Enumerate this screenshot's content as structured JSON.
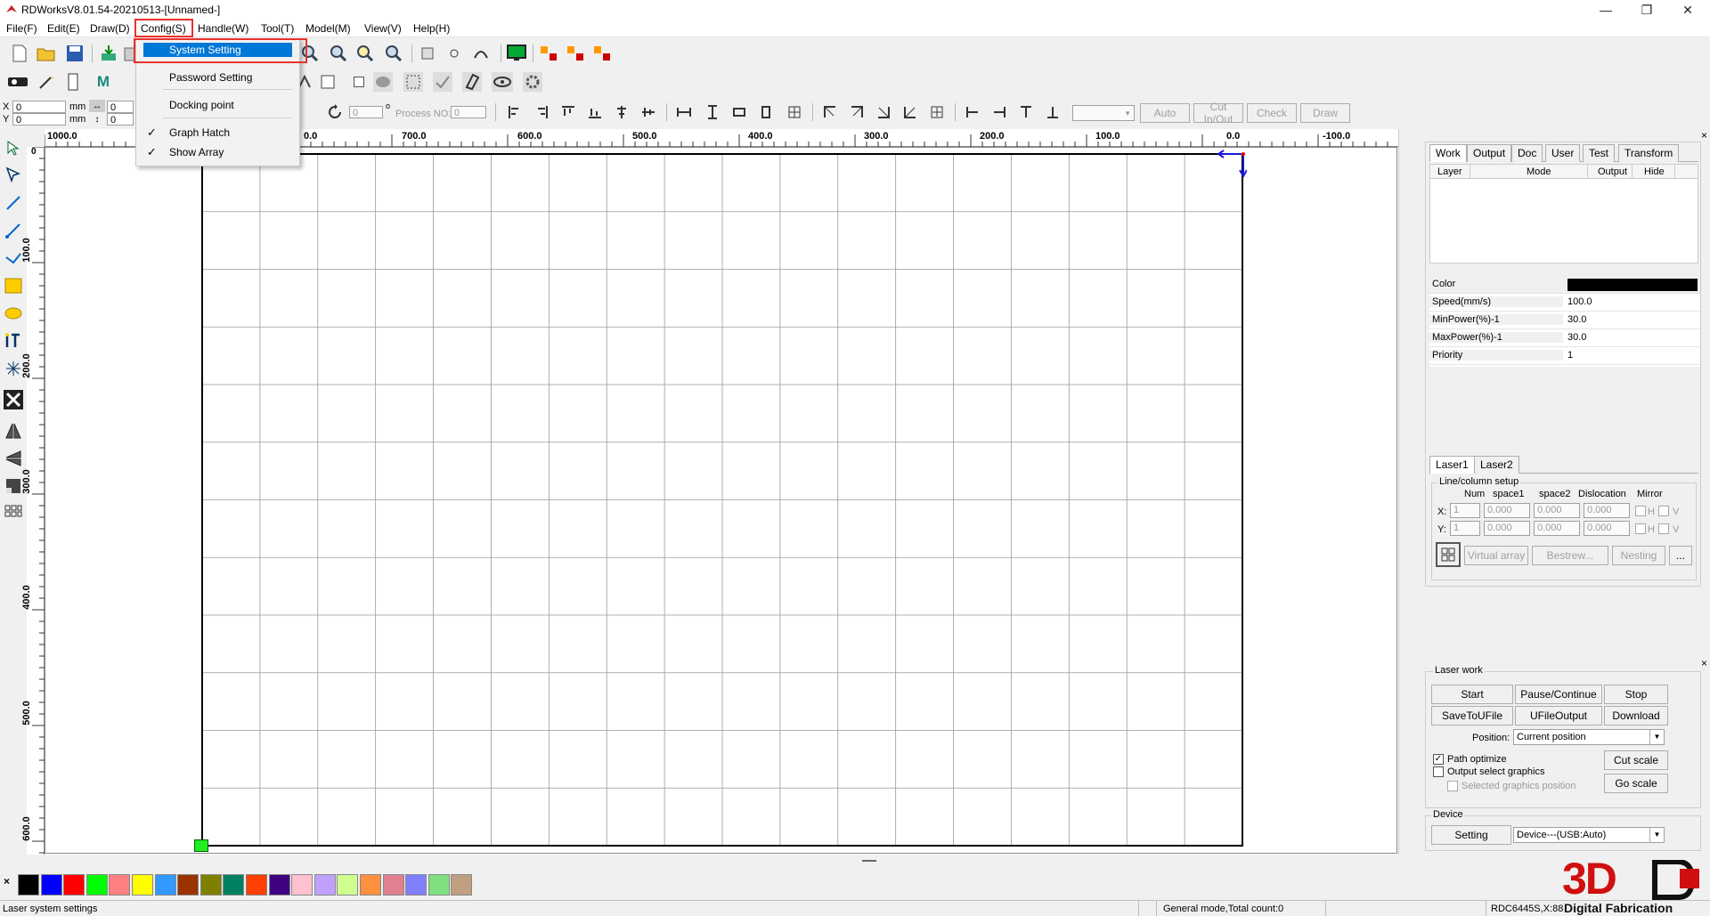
{
  "window": {
    "title": "RDWorksV8.01.54-20210513-[Unnamed-]"
  },
  "menu": [
    "File(F)",
    "Edit(E)",
    "Draw(D)",
    "Config(S)",
    "Handle(W)",
    "Tool(T)",
    "Model(M)",
    "View(V)",
    "Help(H)"
  ],
  "config_menu": {
    "system_setting": "System Setting",
    "password_setting": "Password Setting",
    "docking_point": "Docking point",
    "graph_hatch": "Graph Hatch",
    "show_array": "Show Array"
  },
  "coords": {
    "x_label": "X",
    "y_label": "Y",
    "x_value": "0",
    "y_value": "0",
    "unit": "mm",
    "w_value": "0",
    "h_value": "0",
    "rotate_value": "0",
    "degree": "o",
    "process_no_label": "Process NO:",
    "process_no_value": "0"
  },
  "toolbar3_buttons": {
    "auto": "Auto",
    "cut_in_out": "Cut In/Out",
    "check": "Check",
    "draw": "Draw"
  },
  "ruler_h": [
    "1000.0",
    "700.0",
    "600.0",
    "500.0",
    "400.0",
    "300.0",
    "200.0",
    "100.0",
    "0.0",
    "-100.0"
  ],
  "ruler_h_partial": "0.0",
  "ruler_v": [
    "0",
    "100.0",
    "200.0",
    "300.0",
    "400.0",
    "500.0",
    "600.0"
  ],
  "work_panel": {
    "tabs": [
      "Work",
      "Output",
      "Doc",
      "User",
      "Test",
      "Transform"
    ],
    "columns": [
      "Layer",
      "Mode",
      "Output",
      "Hide"
    ],
    "props": [
      {
        "key": "Color",
        "value": ""
      },
      {
        "key": "Speed(mm/s)",
        "value": "100.0"
      },
      {
        "key": "MinPower(%)-1",
        "value": "30.0"
      },
      {
        "key": "MaxPower(%)-1",
        "value": "30.0"
      },
      {
        "key": "Priority",
        "value": "1"
      }
    ],
    "color_swatch": "#000000",
    "laser_tabs": [
      "Laser1",
      "Laser2"
    ],
    "array_group": "Line/column setup",
    "array_cols": [
      "Num",
      "space1",
      "space2",
      "Dislocation",
      "Mirror"
    ],
    "array_x": {
      "label": "X:",
      "num": "1",
      "s1": "0.000",
      "s2": "0.000",
      "dis": "0.000"
    },
    "array_y": {
      "label": "Y:",
      "num": "1",
      "s1": "0.000",
      "s2": "0.000",
      "dis": "0.000"
    },
    "mirror_h": "H",
    "mirror_v": "V",
    "array_buttons": {
      "virtual": "Virtual array",
      "bestrew": "Bestrew...",
      "nesting": "Nesting",
      "more": "..."
    }
  },
  "laser_work": {
    "group": "Laser work",
    "start": "Start",
    "pause": "Pause/Continue",
    "stop": "Stop",
    "save_u": "SaveToUFile",
    "ufile_out": "UFileOutput",
    "download": "Download",
    "position_label": "Position:",
    "position_value": "Current position",
    "path_optimize": "Path optimize",
    "output_select": "Output select graphics",
    "selected_pos": "Selected graphics position",
    "cut_scale": "Cut scale",
    "go_scale": "Go scale"
  },
  "device": {
    "group": "Device",
    "setting": "Setting",
    "value": "Device---(USB:Auto)"
  },
  "palette": [
    "#000000",
    "#0000ff",
    "#ff0000",
    "#00ff00",
    "#ff8080",
    "#ffff00",
    "#3399ff",
    "#993300",
    "#808000",
    "#008060",
    "#ff4000",
    "#400080",
    "#ffc0d0",
    "#c0a0ff",
    "#d0ff90",
    "#ff9040",
    "#e08090",
    "#8080ff",
    "#80e080",
    "#c0a080"
  ],
  "status": {
    "left": "Laser system settings",
    "mode": "General mode,Total count:0",
    "device": "RDC6445S,X:88"
  },
  "watermark": {
    "big": "3D",
    "small": "Digital Fabrication"
  },
  "colors": {
    "accent": "#0078d7",
    "highlight": "#e8322c",
    "grid": "#999999"
  }
}
